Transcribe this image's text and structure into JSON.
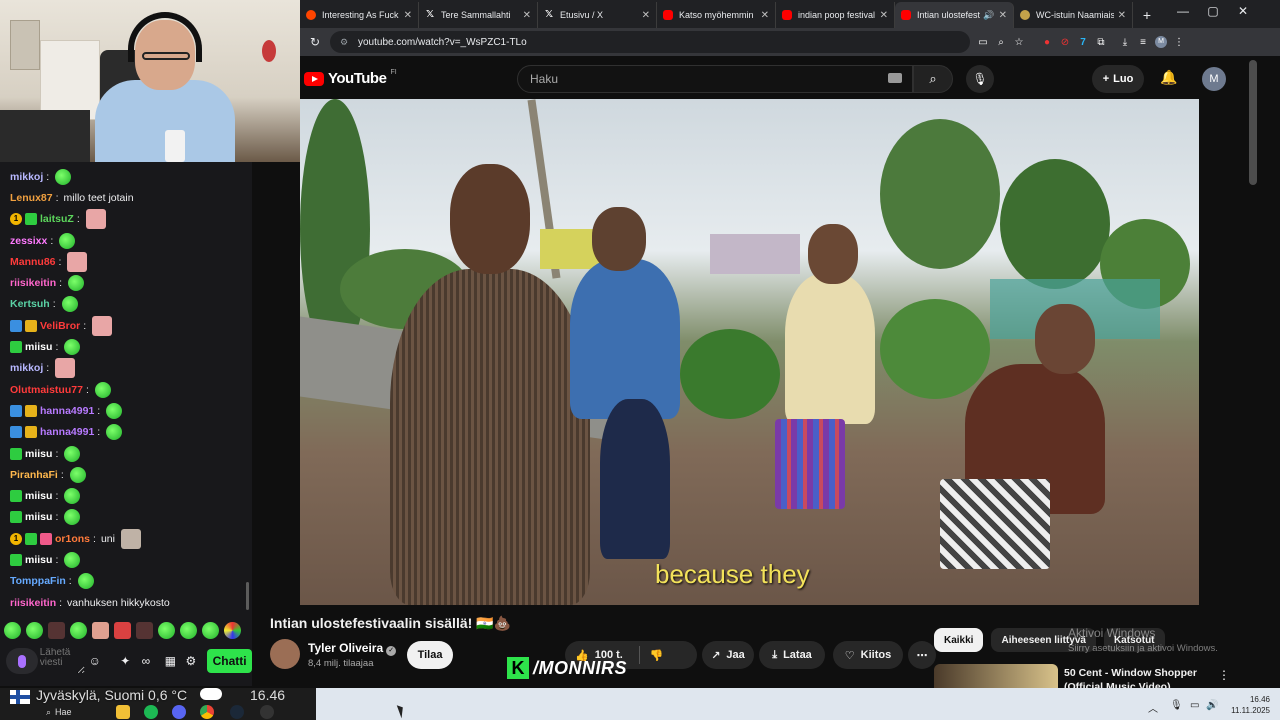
{
  "chat": {
    "messages": [
      {
        "badges": [],
        "user": "mikkoj",
        "color": "#b8b8ff",
        "text": "",
        "emote": "green"
      },
      {
        "badges": [],
        "user": "Lenux87",
        "color": "#f0a040",
        "text": "millo teet jotain",
        "emote": ""
      },
      {
        "badges": [
          "gold",
          "green"
        ],
        "user": "laitsuZ",
        "color": "#5cd65c",
        "text": "",
        "emote": "face"
      },
      {
        "badges": [],
        "user": "zessixx",
        "color": "#ff7aff",
        "text": "",
        "emote": "green"
      },
      {
        "badges": [],
        "user": "Mannu86",
        "color": "#ff3b3b",
        "text": "",
        "emote": "face"
      },
      {
        "badges": [],
        "user": "riisikeitin",
        "color": "#ff66cc",
        "text": "",
        "emote": "green"
      },
      {
        "badges": [],
        "user": "Kertsuh",
        "color": "#5ad1a5",
        "text": "",
        "emote": "green"
      },
      {
        "badges": [
          "blue",
          "crown"
        ],
        "user": "VeliBror",
        "color": "#ff3b3b",
        "text": "",
        "emote": "face"
      },
      {
        "badges": [
          "green"
        ],
        "user": "miisu",
        "color": "#ffffff",
        "text": "",
        "emote": "green"
      },
      {
        "badges": [],
        "user": "mikkoj",
        "color": "#b8b8ff",
        "text": "",
        "emote": "face"
      },
      {
        "badges": [],
        "user": "Olutmaistuu77",
        "color": "#ff3b3b",
        "text": "",
        "emote": "green"
      },
      {
        "badges": [
          "blue",
          "crown"
        ],
        "user": "hanna4991",
        "color": "#b77aff",
        "text": "",
        "emote": "green"
      },
      {
        "badges": [
          "blue",
          "crown"
        ],
        "user": "hanna4991",
        "color": "#b77aff",
        "text": "",
        "emote": "green"
      },
      {
        "badges": [
          "green"
        ],
        "user": "miisu",
        "color": "#ffffff",
        "text": "",
        "emote": "green"
      },
      {
        "badges": [],
        "user": "PiranhaFi",
        "color": "#ffb84d",
        "text": "",
        "emote": "green"
      },
      {
        "badges": [
          "green"
        ],
        "user": "miisu",
        "color": "#ffffff",
        "text": "",
        "emote": "green"
      },
      {
        "badges": [
          "green"
        ],
        "user": "miisu",
        "color": "#ffffff",
        "text": "",
        "emote": "green"
      },
      {
        "badges": [
          "gold",
          "green",
          "pink"
        ],
        "user": "or1ons",
        "color": "#ff7a3b",
        "text": "uni",
        "emote": "cat"
      },
      {
        "badges": [
          "green"
        ],
        "user": "miisu",
        "color": "#ffffff",
        "text": "",
        "emote": "green"
      },
      {
        "badges": [],
        "user": "TomppaFin",
        "color": "#66aaff",
        "text": "",
        "emote": "green"
      },
      {
        "badges": [],
        "user": "riisikeitin",
        "color": "#ff66cc",
        "text": "vanhuksen hikkykosto",
        "emote": ""
      }
    ],
    "input_placeholder": "Lähetä viesti",
    "send_label": "Chatti"
  },
  "browser": {
    "tabs": [
      {
        "title": "Interesting As Fuck",
        "icon": "reddit",
        "active": false
      },
      {
        "title": "Tere Sammallahti",
        "icon": "x",
        "active": false
      },
      {
        "title": "Etusivu / X",
        "icon": "x",
        "active": false
      },
      {
        "title": "Katso myöhemmin",
        "icon": "youtube",
        "active": false
      },
      {
        "title": "indian poop festival",
        "icon": "youtube",
        "active": false
      },
      {
        "title": "Intian ulostefest",
        "icon": "youtube",
        "active": true
      },
      {
        "title": "WC-istuin Naamiais",
        "icon": "wc",
        "active": false
      }
    ],
    "url": "youtube.com/watch?v=_WsPZC1-TLo"
  },
  "youtube": {
    "logo_text": "YouTube",
    "country_code": "FI",
    "search_placeholder": "Haku",
    "create_label": "Luo",
    "avatar_letter": "M",
    "subtitle": "because they",
    "video_title": "Intian ulostefestivaalin sisällä! 🇮🇳💩",
    "channel_name": "Tyler Oliveira",
    "subscribers": "8,4 milj. tilaajaa",
    "subscribe_label": "Tilaa",
    "like_count": "100 t.",
    "share_label": "Jaa",
    "download_label": "Lataa",
    "thanks_label": "Kiitos",
    "chips": [
      "Kaikki",
      "Aiheeseen liittyvä",
      "Katsotut"
    ],
    "rec_title_line1": "50 Cent - Window Shopper",
    "rec_title_line2": "(Official Music Video)"
  },
  "overlay": {
    "brand_letter": "K",
    "brand_text": "/MONNIRS"
  },
  "windows_notice": {
    "title": "Aktivoi Windows",
    "subtitle": "Siirry asetuksiin ja aktivoi Windows."
  },
  "taskbar": {
    "weather": "Jyväskylä, Suomi   0,6 °C",
    "clock_overlay": "16.46",
    "search_label": "Hae",
    "tray_time": "16.46",
    "tray_date": "11.11.2025"
  }
}
